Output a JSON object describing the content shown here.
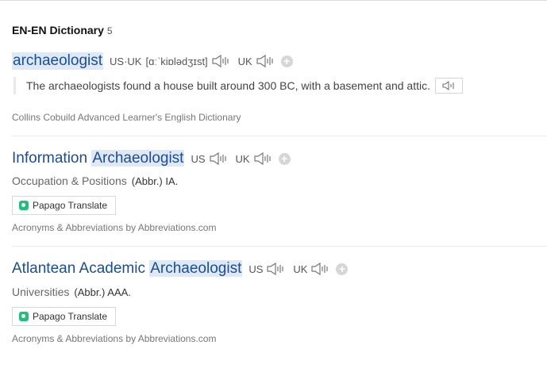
{
  "section": {
    "title": "EN-EN Dictionary",
    "count": "5"
  },
  "entries": [
    {
      "word": "archaeologist",
      "us_label": "US·UK",
      "phonetic": "[ɑːˈkiɒlədʒɪst]",
      "uk_label": "UK",
      "example": "The archaeologists found a house built around 300 BC, with a basement and attic.",
      "source": "Collins Cobuild Advanced Learner's English Dictionary"
    },
    {
      "word_prefix": "Information ",
      "word_highlight": "Archaeologist",
      "us_label": "US",
      "uk_label": "UK",
      "category": "Occupation & Positions",
      "abbr": "(Abbr.) IA.",
      "translate_label": "Papago Translate",
      "source": "Acronyms & Abbreviations by Abbreviations.com"
    },
    {
      "word_prefix": "Atlantean Academic ",
      "word_highlight": "Archaeologist",
      "us_label": "US",
      "uk_label": "UK",
      "category": "Universities",
      "abbr": "(Abbr.) AAA.",
      "translate_label": "Papago Translate",
      "source": "Acronyms & Abbreviations by Abbreviations.com"
    }
  ],
  "icons": {
    "speaker": "speaker-icon",
    "add": "add-circle-icon",
    "papago": "papago-logo-icon"
  },
  "colors": {
    "link": "#1a4c9c",
    "highlight": "#dfe9f6",
    "papago": "#1ec07a"
  }
}
